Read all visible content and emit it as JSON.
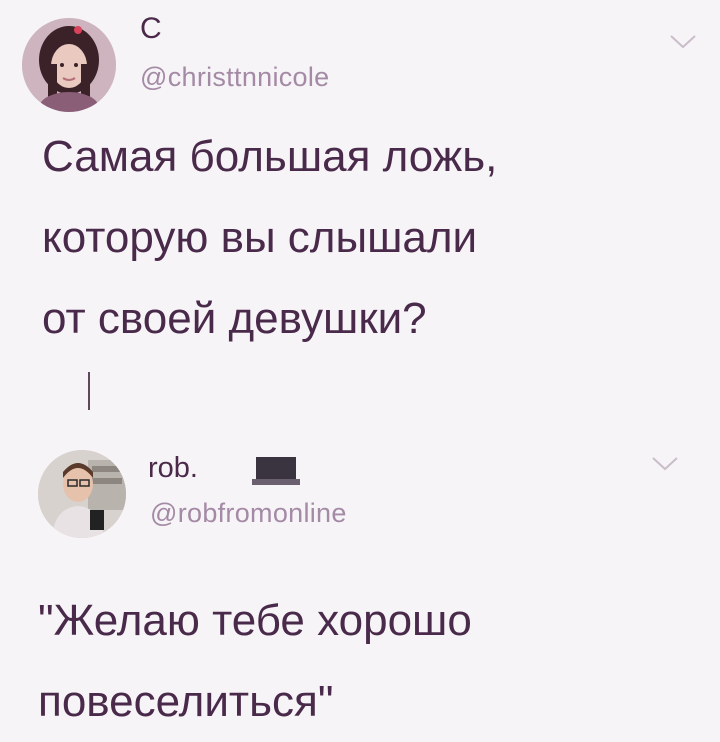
{
  "tweet1": {
    "display_name": "С",
    "handle": "@christtnnicole",
    "text": "Самая большая ложь,\nкоторую вы слышали\nот своей девушки?"
  },
  "tweet2": {
    "display_name": "rob.",
    "handle": "@robfromonline",
    "text": "\"Желаю тебе хорошо\nповеселиться\""
  },
  "icons": {
    "avatar1": "user-avatar-icon",
    "avatar2": "user-avatar-icon",
    "chevron": "chevron-down-icon",
    "badge": "laptop-emoji-icon"
  },
  "colors": {
    "background": "#f6f4f7",
    "text": "#4a2a4a",
    "handle": "#a48aa5"
  }
}
